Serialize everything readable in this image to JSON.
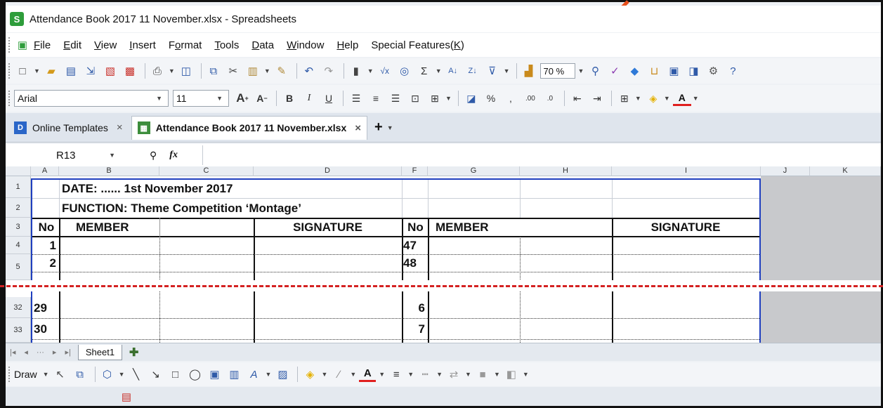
{
  "window": {
    "title": "Attendance Book 2017 11 November.xlsx - Spreadsheets",
    "app_logo": "S"
  },
  "menu": [
    {
      "label": "File",
      "ul": "F",
      "rest": "ile"
    },
    {
      "label": "Edit",
      "ul": "E",
      "rest": "dit"
    },
    {
      "label": "View",
      "ul": "V",
      "rest": "iew"
    },
    {
      "label": "Insert",
      "ul": "I",
      "rest": "nsert"
    },
    {
      "label": "Format",
      "ul": "o",
      "pre": "F",
      "rest": "rmat"
    },
    {
      "label": "Tools",
      "ul": "T",
      "rest": "ools"
    },
    {
      "label": "Data",
      "ul": "D",
      "rest": "ata"
    },
    {
      "label": "Window",
      "ul": "W",
      "rest": "indow"
    },
    {
      "label": "Help",
      "ul": "H",
      "rest": "elp"
    },
    {
      "label": "Special Features(K)",
      "pre": "Special Features(",
      "ul": "K",
      "rest": ")"
    }
  ],
  "toolbar": {
    "zoom": "70 %"
  },
  "format": {
    "font": "Arial",
    "size": "11"
  },
  "tabs": {
    "templates": "Online Templates",
    "document": "Attendance Book 2017 11 November.xlsx",
    "close": "×"
  },
  "formula": {
    "cell_ref": "R13",
    "fx": "fx"
  },
  "columns": [
    "A",
    "B",
    "C",
    "D",
    "F",
    "G",
    "H",
    "I",
    "J",
    "K"
  ],
  "rows": {
    "r1": {
      "num": "1",
      "text": "DATE: ......  1st November 2017"
    },
    "r2": {
      "num": "2",
      "text": "FUNCTION: Theme Competition ‘Montage’"
    },
    "r3": {
      "num": "3",
      "no": "No",
      "member": "MEMBER",
      "signature": "SIGNATURE",
      "no2": "No",
      "member2": "MEMBER",
      "signature2": "SIGNATURE"
    },
    "r4": {
      "num": "4",
      "a": "1",
      "f": "47"
    },
    "r5": {
      "num": "5",
      "a": "2",
      "f": "48"
    },
    "r32": {
      "num": "32",
      "a": "29",
      "f": "6"
    },
    "r33": {
      "num": "33",
      "a": "30",
      "f": "7"
    }
  },
  "sheet": {
    "name": "Sheet1"
  },
  "draw": {
    "label": "Draw"
  },
  "colors": {
    "accent_arrow": "#e8501c",
    "cut_line": "#d42222",
    "table_border": "#1f3fbf"
  }
}
